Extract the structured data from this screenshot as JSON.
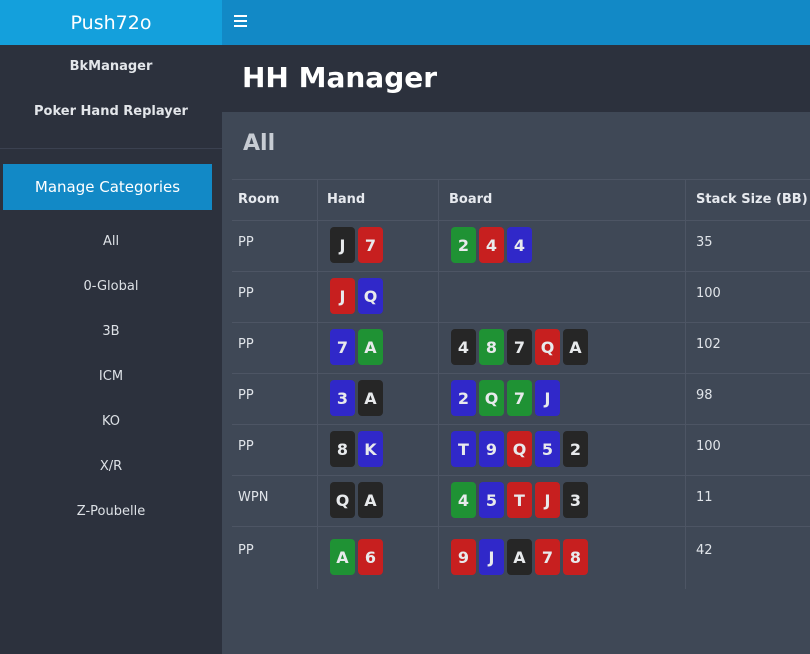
{
  "brand": "Push72o",
  "sidebar": {
    "links": [
      {
        "label": "BkManager"
      },
      {
        "label": "Poker Hand Replayer"
      }
    ],
    "manage_label": "Manage Categories",
    "categories": [
      {
        "label": "All"
      },
      {
        "label": "0-Global"
      },
      {
        "label": "3B"
      },
      {
        "label": "ICM"
      },
      {
        "label": "KO"
      },
      {
        "label": "X/R"
      },
      {
        "label": "Z-Poubelle"
      }
    ]
  },
  "page_title": "HH Manager",
  "section_title": "All",
  "table": {
    "headers": [
      "Room",
      "Hand",
      "Board",
      "Stack Size (BB)"
    ],
    "rows": [
      {
        "room": "PP",
        "hand": [
          {
            "r": "J",
            "s": "black"
          },
          {
            "r": "7",
            "s": "red"
          }
        ],
        "board": [
          {
            "r": "2",
            "s": "green"
          },
          {
            "r": "4",
            "s": "red"
          },
          {
            "r": "4",
            "s": "blue"
          }
        ],
        "stack": "35"
      },
      {
        "room": "PP",
        "hand": [
          {
            "r": "J",
            "s": "red"
          },
          {
            "r": "Q",
            "s": "blue"
          }
        ],
        "board": [],
        "stack": "100"
      },
      {
        "room": "PP",
        "hand": [
          {
            "r": "7",
            "s": "blue"
          },
          {
            "r": "A",
            "s": "green"
          }
        ],
        "board": [
          {
            "r": "4",
            "s": "black"
          },
          {
            "r": "8",
            "s": "green"
          },
          {
            "r": "7",
            "s": "black"
          },
          {
            "r": "Q",
            "s": "red"
          },
          {
            "r": "A",
            "s": "black"
          }
        ],
        "stack": "102"
      },
      {
        "room": "PP",
        "hand": [
          {
            "r": "3",
            "s": "blue"
          },
          {
            "r": "A",
            "s": "black"
          }
        ],
        "board": [
          {
            "r": "2",
            "s": "blue"
          },
          {
            "r": "Q",
            "s": "green"
          },
          {
            "r": "7",
            "s": "green"
          },
          {
            "r": "J",
            "s": "blue"
          }
        ],
        "stack": "98"
      },
      {
        "room": "PP",
        "hand": [
          {
            "r": "8",
            "s": "black"
          },
          {
            "r": "K",
            "s": "blue"
          }
        ],
        "board": [
          {
            "r": "T",
            "s": "blue"
          },
          {
            "r": "9",
            "s": "blue"
          },
          {
            "r": "Q",
            "s": "red"
          },
          {
            "r": "5",
            "s": "blue"
          },
          {
            "r": "2",
            "s": "black"
          }
        ],
        "stack": "100"
      },
      {
        "room": "WPN",
        "hand": [
          {
            "r": "Q",
            "s": "black"
          },
          {
            "r": "A",
            "s": "black"
          }
        ],
        "board": [
          {
            "r": "4",
            "s": "green"
          },
          {
            "r": "5",
            "s": "blue"
          },
          {
            "r": "T",
            "s": "red"
          },
          {
            "r": "J",
            "s": "red"
          },
          {
            "r": "3",
            "s": "black"
          }
        ],
        "stack": "11"
      },
      {
        "room": "PP",
        "hand": [
          {
            "r": "A",
            "s": "green"
          },
          {
            "r": "6",
            "s": "red"
          }
        ],
        "board": [
          {
            "r": "9",
            "s": "red"
          },
          {
            "r": "J",
            "s": "blue"
          },
          {
            "r": "A",
            "s": "black"
          },
          {
            "r": "7",
            "s": "red"
          },
          {
            "r": "8",
            "s": "red"
          }
        ],
        "stack": "42"
      }
    ]
  },
  "colors": {
    "accent": "#1289c6",
    "brand_bg": "#14a0dc",
    "suit_black": "#262626",
    "suit_red": "#c71f1f",
    "suit_green": "#1f9234",
    "suit_blue": "#3028c9"
  }
}
